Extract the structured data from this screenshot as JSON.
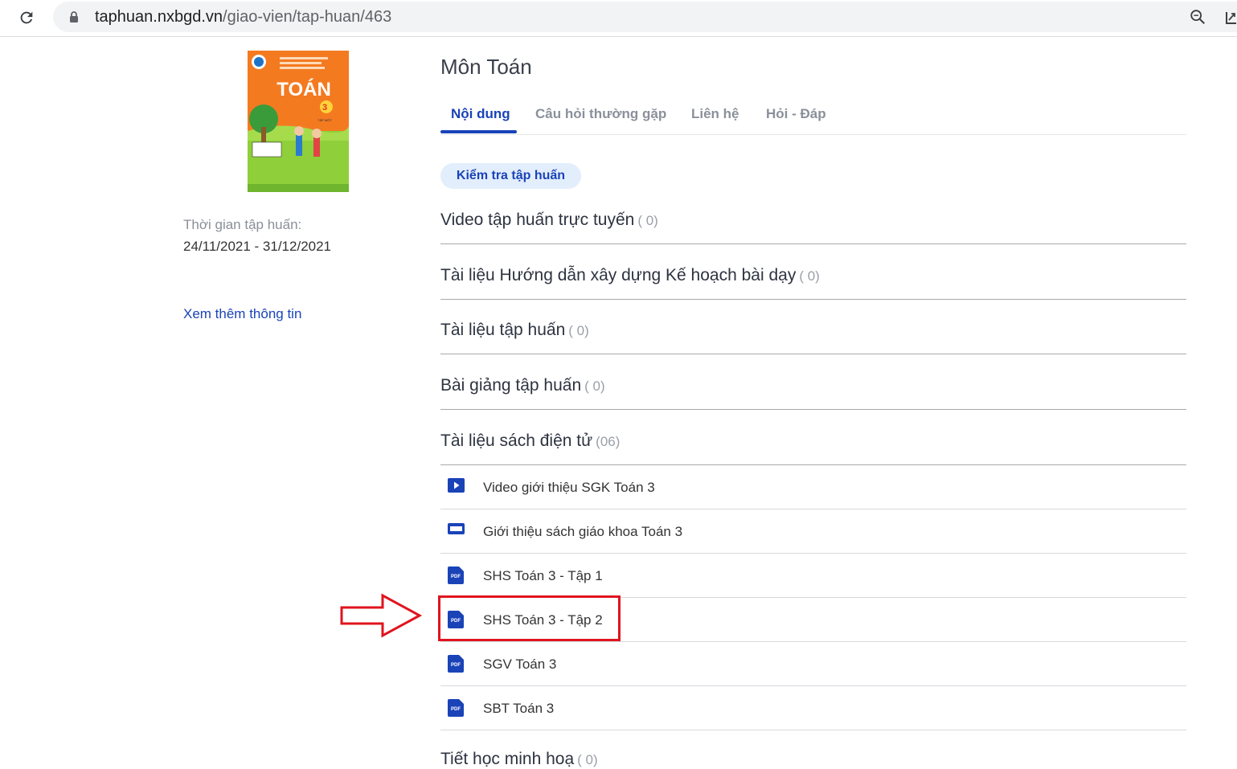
{
  "browser": {
    "url_host": "taphuan.nxbgd.vn",
    "url_path": "/giao-vien/tap-huan/463"
  },
  "sidebar": {
    "cover": {
      "title": "TOÁN",
      "grade": "3",
      "volume": "TẬP MỘT"
    },
    "training_time_label": "Thời gian tập huấn:",
    "training_time_value": "24/11/2021 - 31/12/2021",
    "more_info_link": "Xem thêm thông tin"
  },
  "main": {
    "title": "Môn Toán",
    "tabs": [
      {
        "label": "Nội dung",
        "active": true
      },
      {
        "label": "Câu hỏi thường gặp",
        "active": false
      },
      {
        "label": "Liên hệ",
        "active": false
      },
      {
        "label": "Hỏi - Đáp",
        "active": false
      }
    ],
    "check_button": "Kiểm tra tập huấn",
    "sections": [
      {
        "title": "Video tập huấn trực tuyến",
        "count": "( 0)"
      },
      {
        "title": "Tài liệu Hướng dẫn xây dựng Kế hoạch bài dạy",
        "count": "( 0)"
      },
      {
        "title": "Tài liệu tập huấn",
        "count": "( 0)"
      },
      {
        "title": "Bài giảng tập huấn",
        "count": "( 0)"
      },
      {
        "title": "Tài liệu sách điện tử",
        "count": "(06)"
      },
      {
        "title": "Tiết học minh hoạ",
        "count": "( 0)"
      }
    ],
    "ebook_files": [
      {
        "label": "Video giới thiệu SGK Toán 3",
        "icon": "video-play-icon"
      },
      {
        "label": "Giới thiệu sách giáo khoa Toán 3",
        "icon": "slides-icon"
      },
      {
        "label": "SHS Toán 3 - Tập 1",
        "icon": "pdf-icon"
      },
      {
        "label": "SHS Toán 3 - Tập 2",
        "icon": "pdf-icon"
      },
      {
        "label": "SGV Toán 3",
        "icon": "pdf-icon"
      },
      {
        "label": "SBT Toán 3",
        "icon": "pdf-icon"
      }
    ],
    "pdf_badge_text": "PDF"
  },
  "colors": {
    "accent": "#1a43b8",
    "annotation": "#e0141e"
  }
}
